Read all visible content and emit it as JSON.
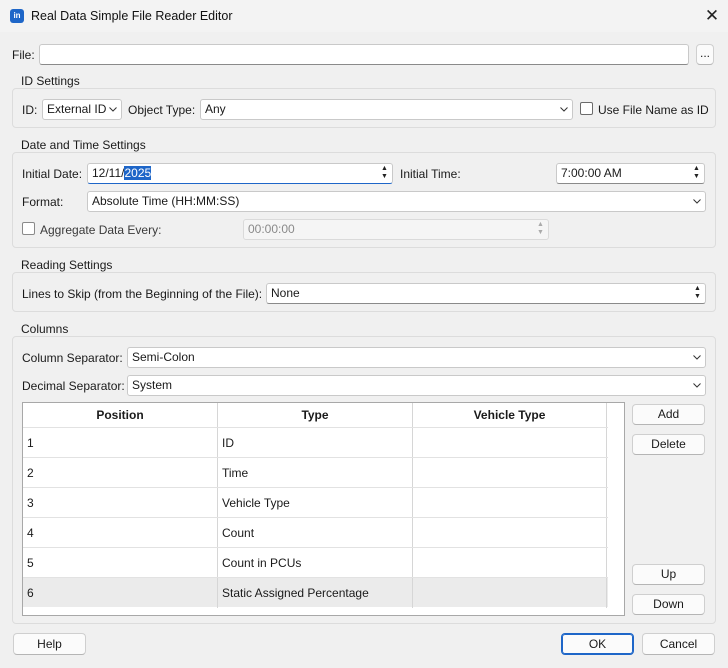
{
  "window": {
    "title": "Real Data Simple File Reader Editor",
    "app_icon_glyph": "in"
  },
  "file": {
    "label": "File:",
    "value": "",
    "browse_label": "..."
  },
  "id_settings": {
    "title": "ID Settings",
    "id_label": "ID:",
    "id_value": "External ID",
    "object_type_label": "Object Type:",
    "object_type_value": "Any",
    "use_file_name_label": "Use File Name as ID",
    "use_file_name_checked": false
  },
  "date_time": {
    "title": "Date and Time Settings",
    "initial_date_label": "Initial Date:",
    "initial_date_prefix": "12/11/",
    "initial_date_selected": "2025",
    "initial_time_label": "Initial Time:",
    "initial_time_value": "7:00:00 AM",
    "format_label": "Format:",
    "format_value": "Absolute Time (HH:MM:SS)",
    "aggregate_label": "Aggregate Data Every:",
    "aggregate_checked": false,
    "aggregate_value": "00:00:00"
  },
  "reading": {
    "title": "Reading Settings",
    "lines_label": "Lines to Skip (from the Beginning of the File):",
    "lines_value": "None"
  },
  "columns": {
    "title": "Columns",
    "separator_label": "Column Separator:",
    "separator_value": "Semi-Colon",
    "decimal_label": "Decimal Separator:",
    "decimal_value": "System",
    "headers": [
      "Position",
      "Type",
      "Vehicle Type"
    ],
    "rows": [
      {
        "position": "1",
        "type": "ID",
        "vehicle_type": ""
      },
      {
        "position": "2",
        "type": "Time",
        "vehicle_type": ""
      },
      {
        "position": "3",
        "type": "Vehicle Type",
        "vehicle_type": ""
      },
      {
        "position": "4",
        "type": "Count",
        "vehicle_type": ""
      },
      {
        "position": "5",
        "type": "Count in PCUs",
        "vehicle_type": ""
      },
      {
        "position": "6",
        "type": "Static Assigned Percentage",
        "vehicle_type": ""
      }
    ],
    "add_label": "Add",
    "delete_label": "Delete",
    "up_label": "Up",
    "down_label": "Down"
  },
  "footer": {
    "help_label": "Help",
    "ok_label": "OK",
    "cancel_label": "Cancel"
  },
  "colors": {
    "accent": "#1e66c8",
    "selected_row": "#ebebeb"
  }
}
